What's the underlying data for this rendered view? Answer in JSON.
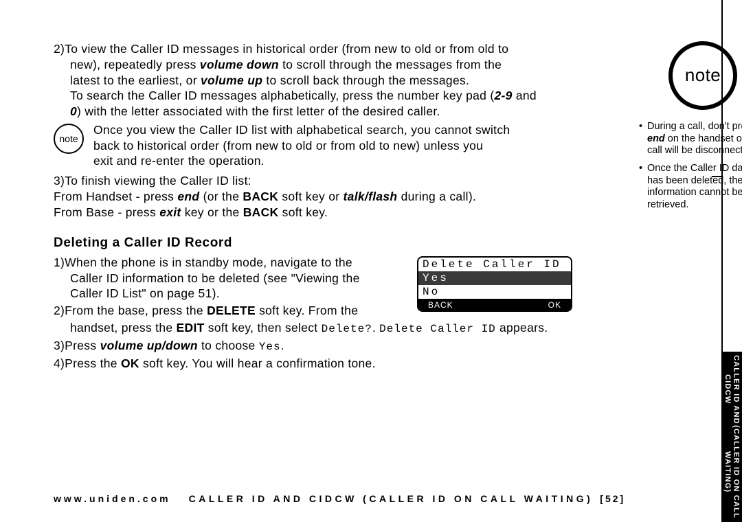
{
  "step2_lines": [
    "To view the Caller ID messages in historical order (from new to old or from old to",
    "new), repeatedly press ",
    " to scroll through the messages from the",
    "latest to the earliest, or ",
    " to scroll back through the messages.",
    "To search the Caller ID messages alphabetically, press the number key pad (",
    " and",
    ") with the letter associated with the first letter of the desired caller."
  ],
  "step2_kw": {
    "vdown": "volume down",
    "vup": "volume up",
    "range": "2-9",
    "zero": "0"
  },
  "inline_note": {
    "label": "note",
    "text_a": "Once you view the Caller ID list with alphabetical search, you cannot switch",
    "text_b": "back to historical order (from new to old or from old to new) unless you",
    "text_c": "exit and re-enter the operation."
  },
  "step3": {
    "line1": "To finish  viewing  the Caller ID list:",
    "hand_a": "From Handset - press ",
    "hand_end": "end",
    "hand_b": " (or the ",
    "hand_back": "BACK",
    "hand_c": " soft key or ",
    "hand_tf": "talk/flash",
    "hand_d": " during a call).",
    "base_a": "From Base - press ",
    "base_exit": "exit",
    "base_b": " key or the ",
    "base_back": "BACK",
    "base_c": " soft key."
  },
  "section_heading": "Deleting a Caller ID Record",
  "del": {
    "s1a": "When the phone is in standby mode, navigate to the",
    "s1b": "Caller ID information to be deleted (see \"Viewing the",
    "s1c": "Caller ID List\" on page 51).",
    "s2a": "From the base, press the ",
    "s2_delete": "DELETE",
    "s2b": " soft key. From the",
    "s2c": "handset, press the ",
    "s2_edit": "EDIT",
    "s2d": " soft key, then select ",
    "s2_delq": "Delete?",
    "s2_dcid": "Delete Caller ID",
    "s2e": " appears.",
    "s3a": "Press ",
    "s3_vud": "volume up/down",
    "s3b": " to choose ",
    "s3_yes": "Yes",
    "s3c": ".",
    "s4a": "Press the ",
    "s4_ok": "OK",
    "s4b": " soft key. You will hear a confirmation tone."
  },
  "lcd": {
    "title": "Delete Caller ID",
    "yes": "Yes",
    "no": "No",
    "back": "BACK",
    "ok": "OK"
  },
  "sidebar": {
    "note_label": "note",
    "b1a": "During a call, don't press ",
    "b1_end": "end",
    "b1b": " on the handset or the call will be disconnected.",
    "b2": "Once the Caller ID data has been deleted, the information cannot be retrieved."
  },
  "footer": {
    "site": "www.uniden.com",
    "mid": "CALLER ID AND CIDCW (CALLER ID ON CALL WAITING)",
    "num": "[52]"
  },
  "side_tab": {
    "l1": "CALLER ID AND CIDCW",
    "l2": "(CALLER ID ON CALL WAITING)"
  }
}
